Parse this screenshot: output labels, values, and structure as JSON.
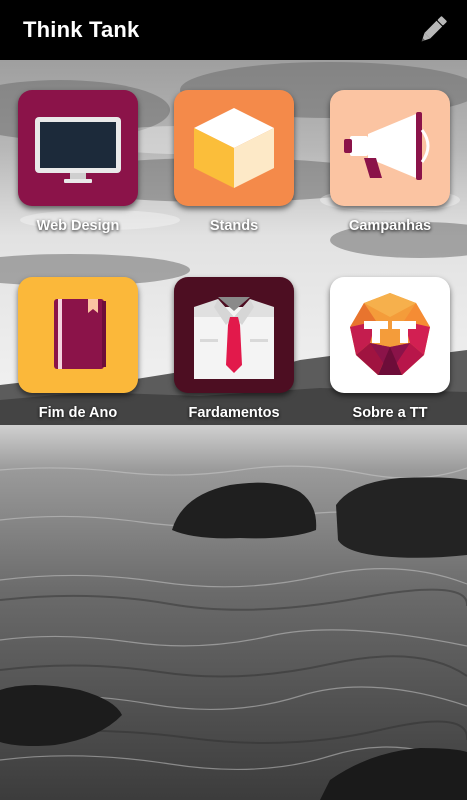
{
  "app_bar": {
    "title": "Think Tank",
    "action_icon": "pencil-icon"
  },
  "tiles": [
    {
      "label": "Web Design",
      "icon": "monitor-icon",
      "color": "#8b1349"
    },
    {
      "label": "Stands",
      "icon": "cube-icon",
      "color": "#f48a4a"
    },
    {
      "label": "Campanhas",
      "icon": "megaphone-icon",
      "color": "#fbc4a2"
    },
    {
      "label": "Fim de Ano",
      "icon": "notebook-icon",
      "color": "#fbb83a"
    },
    {
      "label": "Fardamentos",
      "icon": "shirt-tie-icon",
      "color": "#4d0e22"
    },
    {
      "label": "Sobre a TT",
      "icon": "tt-logo-icon",
      "color": "#ffffff"
    }
  ]
}
